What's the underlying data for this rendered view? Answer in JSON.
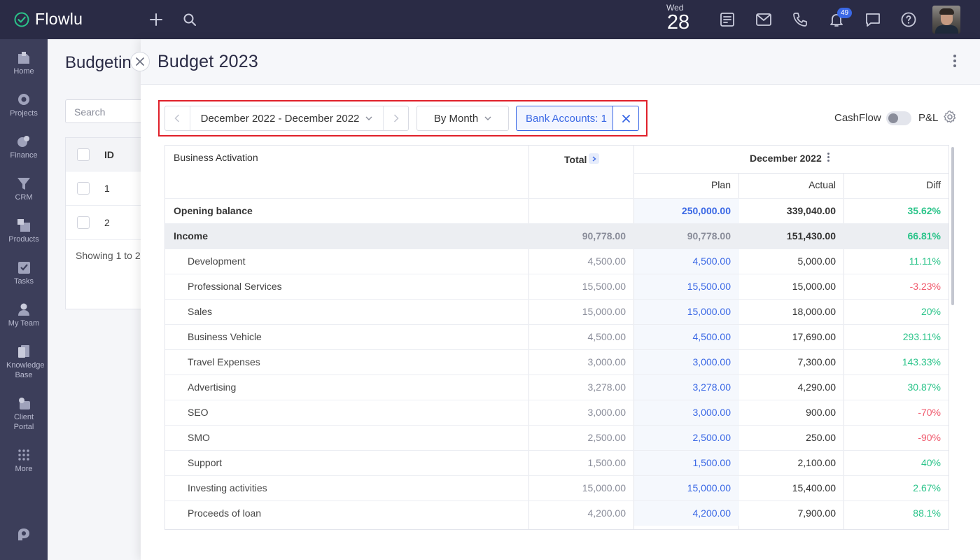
{
  "app": {
    "name": "Flowlu"
  },
  "topbar": {
    "date_dow": "Wed",
    "date_day": "28",
    "notifications_count": "49"
  },
  "sidebar": {
    "items": [
      {
        "label": "Home",
        "icon": "home-icon"
      },
      {
        "label": "Projects",
        "icon": "projects-icon"
      },
      {
        "label": "Finance",
        "icon": "finance-icon"
      },
      {
        "label": "CRM",
        "icon": "crm-icon"
      },
      {
        "label": "Products",
        "icon": "products-icon"
      },
      {
        "label": "Tasks",
        "icon": "tasks-icon"
      },
      {
        "label": "My Team",
        "icon": "team-icon"
      },
      {
        "label": "Knowledge Base",
        "icon": "knowledge-base-icon"
      },
      {
        "label": "Client Portal",
        "icon": "client-portal-icon"
      },
      {
        "label": "More",
        "icon": "more-icon"
      }
    ]
  },
  "background_page": {
    "title": "Budgetin",
    "search_placeholder": "Search",
    "col_id": "ID",
    "rows": [
      "1",
      "2"
    ],
    "footer": "Showing 1 to 2"
  },
  "panel": {
    "title": "Budget 2023",
    "toolbar": {
      "date_range": "December 2022 - December 2022",
      "grouping": "By Month",
      "bank_accounts": "Bank Accounts: 1",
      "cashflow_label": "CashFlow",
      "pl_label": "P&L"
    },
    "table": {
      "header_title": "Business Activation",
      "total_label": "Total",
      "period_label": "December 2022",
      "plan_label": "Plan",
      "actual_label": "Actual",
      "diff_label": "Diff",
      "rows": [
        {
          "name": "Opening balance",
          "total": "",
          "plan": "250,000.00",
          "actual": "339,040.00",
          "diff": "35.62%",
          "diff_sign": "pos",
          "kind": "bold"
        },
        {
          "name": "Income",
          "total": "90,778.00",
          "plan": "90,778.00",
          "actual": "151,430.00",
          "diff": "66.81%",
          "diff_sign": "pos",
          "kind": "income"
        },
        {
          "name": "Development",
          "total": "4,500.00",
          "plan": "4,500.00",
          "actual": "5,000.00",
          "diff": "11.11%",
          "diff_sign": "pos",
          "kind": "sub"
        },
        {
          "name": "Professional Services",
          "total": "15,500.00",
          "plan": "15,500.00",
          "actual": "15,000.00",
          "diff": "-3.23%",
          "diff_sign": "neg",
          "kind": "sub"
        },
        {
          "name": "Sales",
          "total": "15,000.00",
          "plan": "15,000.00",
          "actual": "18,000.00",
          "diff": "20%",
          "diff_sign": "pos",
          "kind": "sub"
        },
        {
          "name": "Business Vehicle",
          "total": "4,500.00",
          "plan": "4,500.00",
          "actual": "17,690.00",
          "diff": "293.11%",
          "diff_sign": "pos",
          "kind": "sub"
        },
        {
          "name": "Travel Expenses",
          "total": "3,000.00",
          "plan": "3,000.00",
          "actual": "7,300.00",
          "diff": "143.33%",
          "diff_sign": "pos",
          "kind": "sub"
        },
        {
          "name": "Advertising",
          "total": "3,278.00",
          "plan": "3,278.00",
          "actual": "4,290.00",
          "diff": "30.87%",
          "diff_sign": "pos",
          "kind": "sub"
        },
        {
          "name": "SEO",
          "total": "3,000.00",
          "plan": "3,000.00",
          "actual": "900.00",
          "diff": "-70%",
          "diff_sign": "neg",
          "kind": "sub"
        },
        {
          "name": "SMO",
          "total": "2,500.00",
          "plan": "2,500.00",
          "actual": "250.00",
          "diff": "-90%",
          "diff_sign": "neg",
          "kind": "sub"
        },
        {
          "name": "Support",
          "total": "1,500.00",
          "plan": "1,500.00",
          "actual": "2,100.00",
          "diff": "40%",
          "diff_sign": "pos",
          "kind": "sub"
        },
        {
          "name": "Investing activities",
          "total": "15,000.00",
          "plan": "15,000.00",
          "actual": "15,400.00",
          "diff": "2.67%",
          "diff_sign": "pos",
          "kind": "sub"
        },
        {
          "name": "Proceeds of loan",
          "total": "4,200.00",
          "plan": "4,200.00",
          "actual": "7,900.00",
          "diff": "88.1%",
          "diff_sign": "pos",
          "kind": "sub"
        }
      ]
    }
  },
  "colors": {
    "topbar": "#2a2b45",
    "sidebar": "#3c3e5a",
    "accent": "#3a68e5",
    "positive": "#2bc48a",
    "negative": "#f05b6e",
    "highlight": "#e0202a"
  }
}
